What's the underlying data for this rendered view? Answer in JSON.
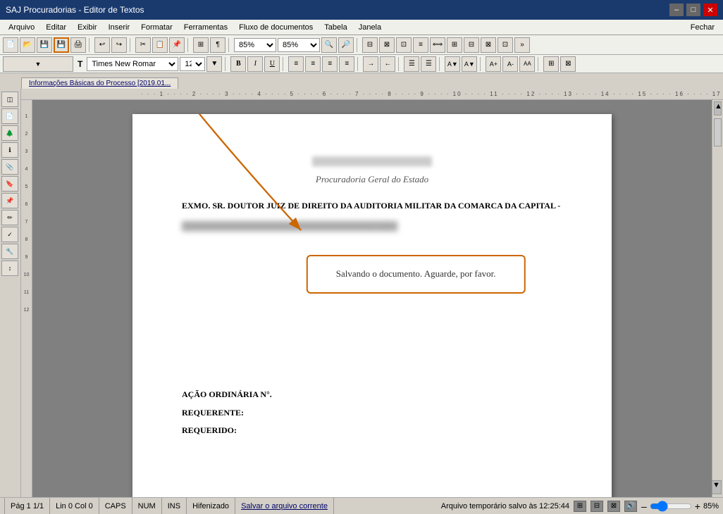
{
  "titlebar": {
    "title": "SAJ Procuradorias - Editor de Textos",
    "minimize": "–",
    "maximize": "□",
    "close": "✕"
  },
  "menubar": {
    "items": [
      "Arquivo",
      "Editar",
      "Exibir",
      "Inserir",
      "Formatar",
      "Ferramentas",
      "Fluxo de documentos",
      "Tabela",
      "Janela"
    ],
    "fechar": "Fechar"
  },
  "toolbar": {
    "zoom1": "85%",
    "zoom2": "85%"
  },
  "toolbar2": {
    "font": "Times New Romar",
    "size": "12"
  },
  "tab": {
    "label": "Informações Básicas do Processo [2019.01..."
  },
  "document": {
    "header_italic": "Procuradoria Geral do Estado",
    "title_blur": "████████████████",
    "paragraph1": "EXMO. SR. DOUTOR JUIZ DE DIREITO DA AUDITORIA MILITAR DA COMARCA DA CAPITAL -",
    "paragraph2_blurred": "████████████████████████████",
    "saving_message": "Salvando o documento. Aguarde, por favor.",
    "section1": "AÇÃO ORDINÁRIA N°.",
    "section2": "REQUERENTE:",
    "section3": "REQUERIDO:"
  },
  "statusbar": {
    "page": "Pág 1",
    "page_fraction": "1/1",
    "lin_col": "Lin 0  Col 0",
    "caps": "CAPS",
    "num": "NUM",
    "ins": "INS",
    "hifenizado": "Hifenizado",
    "salvar": "Salvar o arquivo corrente",
    "arquivo_temp": "Arquivo temporário salvo às 12:25:44",
    "zoom": "85%"
  },
  "ruler": {
    "marks": "· · · 1 · · · · 2 · · · · 3 · · · · 4 · · · · 5 · · · · 6 · · · · 7 · · · · 8 · · · · 9 · · · · 10 · · · · 11 · · · · 12 · · · · 13 · · · · 14 · · · · 15 · · · · 16 · · · · 17 · · ·"
  }
}
